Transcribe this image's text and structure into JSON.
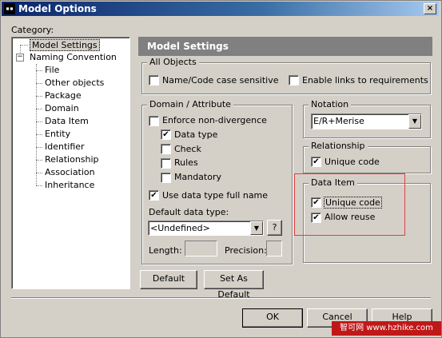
{
  "window": {
    "title": "Model Options",
    "close_glyph": "×"
  },
  "category": {
    "label": "Category:",
    "tree": [
      {
        "label": "Model Settings",
        "selected": true
      },
      {
        "label": "Naming Convention",
        "expander": "−"
      },
      {
        "label": "File"
      },
      {
        "label": "Other objects"
      },
      {
        "label": "Package"
      },
      {
        "label": "Domain"
      },
      {
        "label": "Data Item"
      },
      {
        "label": "Entity"
      },
      {
        "label": "Identifier"
      },
      {
        "label": "Relationship"
      },
      {
        "label": "Association"
      },
      {
        "label": "Inheritance"
      }
    ]
  },
  "panel": {
    "header": "Model Settings"
  },
  "all_objects": {
    "label": "All Objects",
    "name_code_case": {
      "label": "Name/Code case sensitive",
      "checked": false
    },
    "enable_links": {
      "label": "Enable links to requirements",
      "checked": false
    }
  },
  "domain_attribute": {
    "label": "Domain / Attribute",
    "enforce_non_divergence": {
      "label": "Enforce non-divergence",
      "checked": false
    },
    "data_type": {
      "label": "Data type",
      "checked": true
    },
    "check": {
      "label": "Check",
      "checked": false
    },
    "rules": {
      "label": "Rules",
      "checked": false
    },
    "mandatory": {
      "label": "Mandatory",
      "checked": false
    },
    "use_full_name": {
      "label": "Use data type full name",
      "checked": true
    },
    "default_data_type_label": "Default data type:",
    "default_data_type_value": "<Undefined>",
    "help_glyph": "?",
    "length_label": "Length:",
    "precision_label": "Precision:"
  },
  "notation": {
    "label": "Notation",
    "value": "E/R+Merise"
  },
  "relationship": {
    "label": "Relationship",
    "unique_code": {
      "label": "Unique code",
      "checked": true
    }
  },
  "data_item": {
    "label": "Data Item",
    "unique_code": {
      "label": "Unique code",
      "checked": true
    },
    "allow_reuse": {
      "label": "Allow reuse",
      "checked": true
    },
    "highlight_color": "#e04040"
  },
  "buttons": {
    "default": "Default",
    "set_as_default": "Set As Default",
    "ok": "OK",
    "cancel": "Cancel",
    "help": "Help"
  },
  "watermark": "智可网 www.hzhike.com",
  "check_glyph": "✔",
  "arrow_glyph": "▼"
}
